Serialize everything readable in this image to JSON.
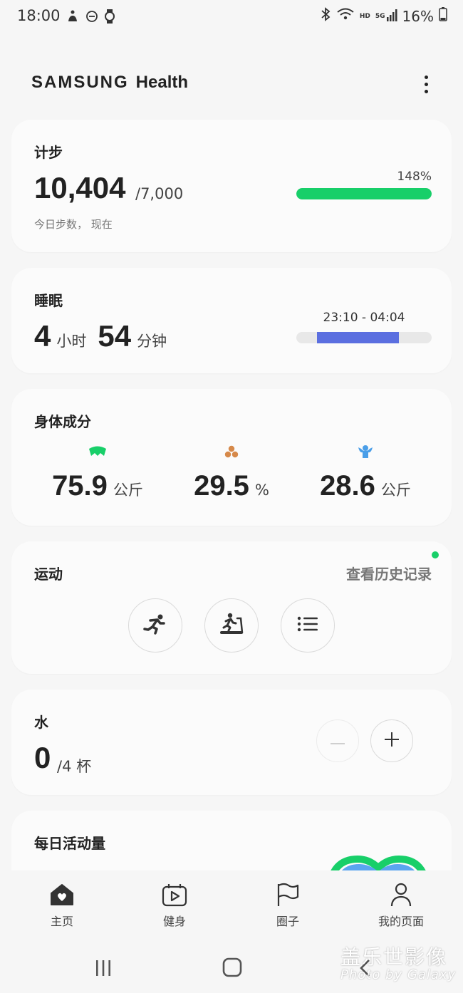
{
  "status_bar": {
    "time": "18:00",
    "network": "HD",
    "signal": "5G",
    "battery": "16%",
    "left_icons": [
      "accessibility-icon",
      "do-not-disturb-icon",
      "watch-icon"
    ],
    "right_icons": [
      "bluetooth-icon",
      "wifi-icon",
      "signal-icon",
      "battery-icon"
    ]
  },
  "header": {
    "brand_samsung": "SAMSUNG",
    "brand_health": "Health",
    "more_icon": "more-vertical-icon"
  },
  "steps": {
    "title": "计步",
    "value": "10,404",
    "goal": "/7,000",
    "subtitle": "今日步数， 现在",
    "percent_label": "148%",
    "progress_fraction": 1.0,
    "bar_color": "#18cf69"
  },
  "sleep": {
    "title": "睡眠",
    "hours": "4",
    "hours_unit": "小时",
    "minutes": "54",
    "minutes_unit": "分钟",
    "range": "23:10 - 04:04",
    "bar_start_fraction": 0.15,
    "bar_end_fraction": 0.76,
    "bar_color": "#5b6fe0"
  },
  "body_composition": {
    "title": "身体成分",
    "metrics": [
      {
        "icon": "body-fat-free-mass-icon",
        "value": "75.9",
        "unit": "公斤",
        "color": "#18cf69"
      },
      {
        "icon": "body-fat-icon",
        "value": "29.5",
        "unit": "%",
        "color": "#d6894a"
      },
      {
        "icon": "skeletal-muscle-icon",
        "value": "28.6",
        "unit": "公斤",
        "color": "#4a9ee8"
      }
    ]
  },
  "exercise": {
    "title": "运动",
    "history_link": "查看历史记录",
    "buttons": [
      "running-icon",
      "treadmill-icon",
      "list-icon"
    ],
    "dot_color": "#18cf69"
  },
  "water": {
    "title": "水",
    "value": "0",
    "goal": "/4 杯"
  },
  "daily_activity": {
    "title": "每日活动量"
  },
  "bottom_nav": {
    "items": [
      {
        "label": "主页",
        "icon": "home-heart-icon"
      },
      {
        "label": "健身",
        "icon": "fitness-video-icon"
      },
      {
        "label": "圈子",
        "icon": "flag-icon"
      },
      {
        "label": "我的页面",
        "icon": "person-icon"
      }
    ]
  },
  "watermark": {
    "line1": "盖乐世影像",
    "line2": "Photo by Galaxy"
  }
}
